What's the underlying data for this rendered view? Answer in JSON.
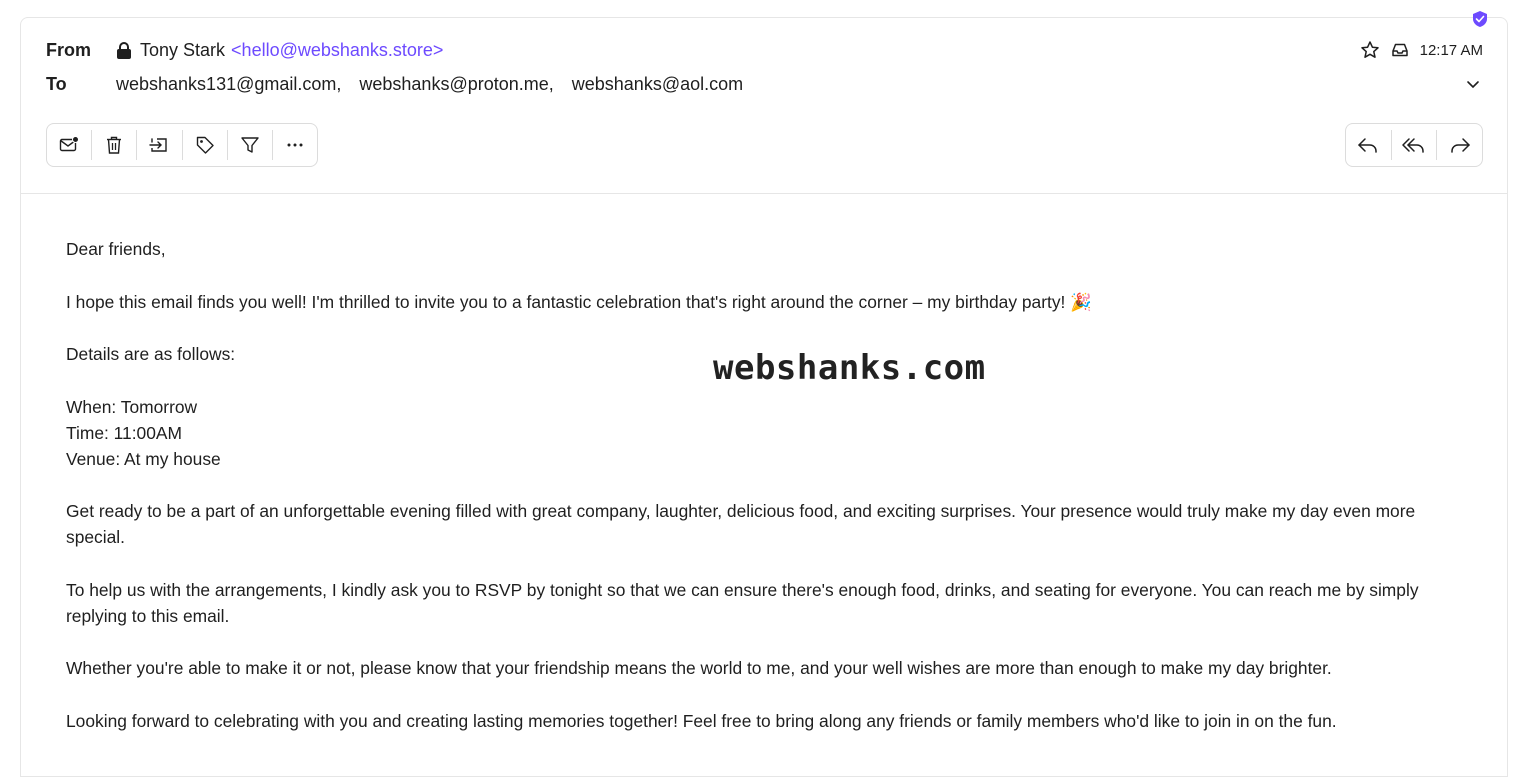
{
  "header": {
    "from_label": "From",
    "to_label": "To",
    "sender_name": "Tony Stark",
    "sender_email": "<hello@webshanks.store>",
    "recipients": [
      "webshanks131@gmail.com,",
      "webshanks@proton.me,",
      "webshanks@aol.com"
    ],
    "time": "12:17 AM"
  },
  "toolbar": {
    "left_icons": [
      "mark-unread-icon",
      "trash-icon",
      "move-to-icon",
      "label-icon",
      "filter-icon",
      "more-icon"
    ],
    "right_icons": [
      "reply-icon",
      "reply-all-icon",
      "forward-icon"
    ]
  },
  "body": {
    "greeting": "Dear friends,",
    "intro": "I hope this email finds you well! I'm thrilled to invite you to a fantastic celebration that's right around the corner – my birthday party! 🎉",
    "details_heading": "Details are as follows:",
    "when": "When: Tomorrow",
    "time": "Time: 11:00AM",
    "venue": "Venue: At my house",
    "para1": "Get ready to be a part of an unforgettable evening filled with great company, laughter, delicious food, and exciting surprises. Your presence would truly make my day even more special.",
    "para2": "To help us with the arrangements, I kindly ask you to RSVP by tonight so that we can ensure there's enough food, drinks, and seating for everyone. You can reach me by simply replying to this email.",
    "para3": "Whether you're able to make it or not, please know that your friendship means the world to me, and your well wishes are more than enough to make my day brighter.",
    "para4": "Looking forward to celebrating with you and creating lasting memories together! Feel free to bring along any friends or family members who'd like to join in on the fun."
  },
  "watermark": "webshanks.com",
  "colors": {
    "accent": "#6d4aff"
  }
}
